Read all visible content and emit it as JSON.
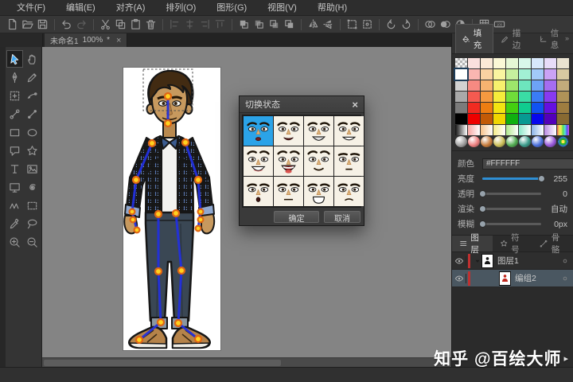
{
  "menu": {
    "items": [
      {
        "name": "file",
        "label": "文件(F)"
      },
      {
        "name": "edit",
        "label": "编辑(E)"
      },
      {
        "name": "align",
        "label": "对齐(A)"
      },
      {
        "name": "arrange",
        "label": "排列(O)"
      },
      {
        "name": "shape",
        "label": "图形(G)"
      },
      {
        "name": "view",
        "label": "视图(V)"
      },
      {
        "name": "help",
        "label": "帮助(H)"
      }
    ]
  },
  "toolbar": {
    "groups": [
      [
        "new",
        "open",
        "save"
      ],
      [
        "undo",
        "redo"
      ],
      [
        "cut",
        "copy",
        "paste",
        "delete"
      ],
      [
        "align-left",
        "align-center",
        "align-right",
        "align-top"
      ],
      [
        "bring-to-front",
        "bring-forward",
        "send-backward",
        "send-to-back"
      ],
      [
        "flip-horizontal",
        "flip-vertical"
      ],
      [
        "free-transform",
        "transform-anchor"
      ],
      [
        "rotate-left",
        "rotate-right"
      ],
      [
        "mask",
        "mask-fill",
        "mask-invert"
      ],
      [
        "grid",
        "zoom-100"
      ]
    ],
    "disabled": [
      "redo",
      "align-left",
      "align-center",
      "align-right",
      "align-top"
    ]
  },
  "tab": {
    "title": "未命名1",
    "zoom": "100%",
    "modified": "*",
    "close": "×"
  },
  "toolbox": {
    "active": "select",
    "tools": [
      "select",
      "hand",
      "pen",
      "pencil",
      "free-deform",
      "anchor-edit",
      "bone",
      "bind",
      "rectangle",
      "ellipse",
      "callout",
      "star",
      "text",
      "image",
      "window",
      "spiral",
      "zigzag",
      "frame",
      "eyedropper",
      "lasso",
      "zoom-in",
      "zoom-out"
    ]
  },
  "dialog": {
    "title": "切换状态",
    "close": "×",
    "ok_label": "确定",
    "cancel_label": "取消",
    "faces": [
      {
        "expression": "neutral",
        "mouth": "dot",
        "brows": "arch",
        "selected": true
      },
      {
        "expression": "slight-smile",
        "mouth": "smileopen",
        "brows": "arch",
        "selected": false
      },
      {
        "expression": "big-grin",
        "mouth": "grin",
        "brows": "arch",
        "selected": false
      },
      {
        "expression": "wide-smile",
        "mouth": "widesmile",
        "brows": "arch",
        "selected": false
      },
      {
        "expression": "laughing",
        "mouth": "laugh",
        "brows": "high",
        "selected": false
      },
      {
        "expression": "open-laugh",
        "mouth": "laughbig",
        "brows": "high",
        "selected": false
      },
      {
        "expression": "soft-smile",
        "mouth": "softsmile",
        "brows": "high",
        "selected": false
      },
      {
        "expression": "calm",
        "mouth": "closed",
        "brows": "flat",
        "selected": false
      },
      {
        "expression": "surprised",
        "mouth": "o",
        "brows": "low",
        "selected": false
      },
      {
        "expression": "neutral-line",
        "mouth": "line",
        "brows": "low",
        "selected": false
      },
      {
        "expression": "shouting",
        "mouth": "opend",
        "brows": "low",
        "selected": false
      },
      {
        "expression": "frown",
        "mouth": "frown",
        "brows": "low",
        "selected": false
      }
    ]
  },
  "right_panel": {
    "overflow": "»",
    "tabs": [
      {
        "name": "fill",
        "icon": "fill",
        "label": "填充",
        "active": true
      },
      {
        "name": "stroke",
        "icon": "stroke",
        "label": "描边",
        "active": false
      },
      {
        "name": "info",
        "icon": "info",
        "label": "信息",
        "active": false
      }
    ],
    "palette": {
      "selected": [
        1,
        0
      ],
      "rows": [
        [
          "checker",
          "#fbe0dd",
          "#fbead8",
          "#fbf8d6",
          "#e6f7d5",
          "#d8f7ea",
          "#d8e8fb",
          "#e8dcf9",
          "#e9e2d0"
        ],
        [
          "#ffffff",
          "#f9b6b1",
          "#f9d2a2",
          "#f9f5a0",
          "#c6f09e",
          "#a2f0d4",
          "#a2c9f9",
          "#caa2f5",
          "#d8caa2"
        ],
        [
          "#d2d2d2",
          "#f78a82",
          "#f7b270",
          "#f7f16d",
          "#9de66b",
          "#6de6bd",
          "#6da3f7",
          "#a56df1",
          "#c2ab7b"
        ],
        [
          "#a9a9a9",
          "#f55a50",
          "#f59940",
          "#f5ec3b",
          "#70dd3a",
          "#3adca5",
          "#3a7cf5",
          "#883af0",
          "#b09358"
        ],
        [
          "#7b7b7b",
          "#f12b21",
          "#ed7d12",
          "#f3e411",
          "#44d010",
          "#10cc8f",
          "#1053f1",
          "#6510e0",
          "#9e7d40"
        ],
        [
          "#000000",
          "#ee0000",
          "#c25a07",
          "#f0d600",
          "#10b010",
          "#079a92",
          "#0707ee",
          "#5300ba",
          "#886a32"
        ],
        [
          "grad:#111111",
          "grad:#f7a6a2",
          "grad:#f7c38c",
          "grad:#f7ee8a",
          "grad:#b0e88c",
          "grad:#8ce8ca",
          "grad:#8cb4e8",
          "grad:#ba8ce4",
          "rainbow"
        ],
        [
          "sphere:#a0a0a0",
          "sphere:#ee8080",
          "sphere:#c87c3c",
          "sphere:#cdc05a",
          "sphere:#52ac52",
          "sphere:#3c9c8c",
          "sphere:#4c70dc",
          "sphere:#9858dc",
          "target"
        ]
      ]
    },
    "properties": {
      "color_label": "颜色",
      "color_value": "#FFFFFF",
      "sliders": [
        {
          "key": "brightness",
          "label": "亮度",
          "value": "255",
          "percent": 100,
          "accent": true
        },
        {
          "key": "opacity",
          "label": "透明",
          "value": "0",
          "percent": 0,
          "accent": false
        },
        {
          "key": "render",
          "label": "渲染",
          "value": "自动",
          "percent": 0,
          "accent": false
        },
        {
          "key": "blur",
          "label": "模糊",
          "value": "0px",
          "percent": 0,
          "accent": false
        }
      ]
    },
    "layers": {
      "tabs": [
        {
          "name": "layers",
          "icon": "layers",
          "label": "图层",
          "active": true
        },
        {
          "name": "symbols",
          "icon": "symbols",
          "label": "符号",
          "active": false
        },
        {
          "name": "bones",
          "icon": "bones",
          "label": "骨骼",
          "active": false
        }
      ],
      "rows": [
        {
          "label": "图层1",
          "thumb": "black",
          "expanded": true,
          "indent": 0,
          "selected": false
        },
        {
          "label": "编组2",
          "thumb": "red",
          "indent": 1,
          "selected": true
        }
      ]
    }
  },
  "watermark": {
    "text": "知乎 @百绘大师",
    "arrow": "▸"
  },
  "colors": {
    "accent_blue": "#2ba3e8",
    "slider_blue": "#2e8fd5",
    "layer_red_bar": "#c03030",
    "canvas_gray": "#848484",
    "selected_layer": "#4a5761"
  }
}
